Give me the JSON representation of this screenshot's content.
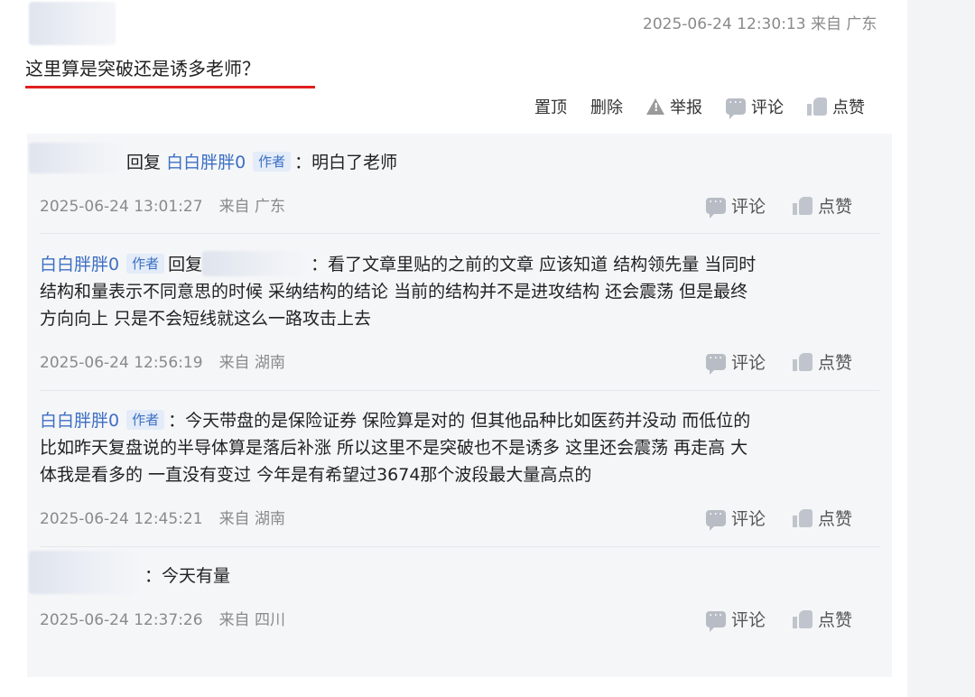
{
  "post": {
    "time": "2025-06-24 12:30:13 来自 广东",
    "text": "这里算是突破还是诱多老师？",
    "actions": {
      "pin": "置顶",
      "delete": "删除",
      "report": "举报",
      "comment": "评论",
      "like": "点赞"
    }
  },
  "replies": [
    {
      "prefix": "回复",
      "reply_to": "白白胖胖0",
      "badge": "作者",
      "text": "：明白了老师",
      "time": "2025-06-24 13:01:27",
      "location": "来自 广东",
      "comment": "评论",
      "like": "点赞"
    },
    {
      "author": "白白胖胖0",
      "badge": "作者",
      "prefix": "回复",
      "line1": "：看了文章里贴的之前的文章 应该知道 结构领先量 当同时",
      "line2": "结构和量表示不同意思的时候 采纳结构的结论 当前的结构并不是进攻结构 还会震荡 但是最终",
      "line3": "方向向上 只是不会短线就这么一路攻击上去",
      "time": "2025-06-24 12:56:19",
      "location": "来自 湖南",
      "comment": "评论",
      "like": "点赞"
    },
    {
      "author": "白白胖胖0",
      "badge": "作者",
      "line1": "：今天带盘的是保险证券 保险算是对的 但其他品种比如医药并没动 而低位的",
      "line2": "比如昨天复盘说的半导体算是落后补涨 所以这里不是突破也不是诱多 这里还会震荡 再走高 大",
      "line3": "体我是看多的 一直没有变过 今年是有希望过3674那个波段最大量高点的",
      "time": "2025-06-24 12:45:21",
      "location": "来自 湖南",
      "comment": "评论",
      "like": "点赞"
    },
    {
      "text": "：今天有量",
      "time": "2025-06-24 12:37:26",
      "location": "来自 四川",
      "comment": "评论",
      "like": "点赞"
    }
  ]
}
